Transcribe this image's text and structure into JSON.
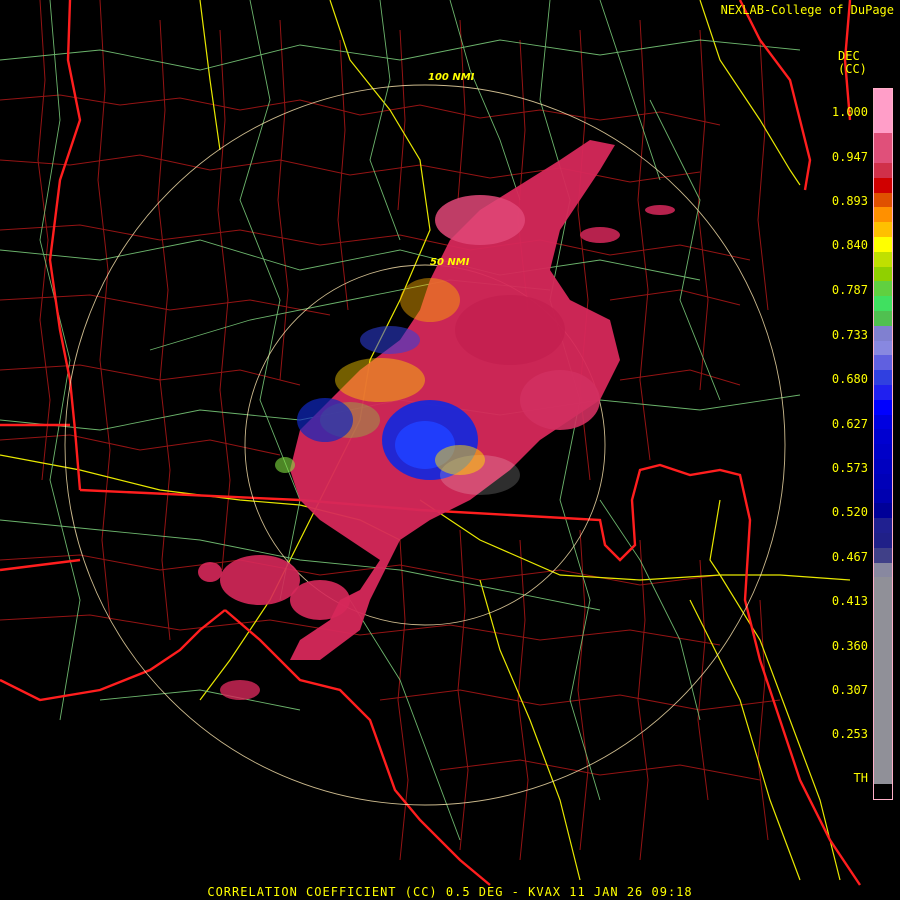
{
  "credit": "NEXLAB-College of DuPage",
  "units": {
    "line1": "DEC",
    "line2": "(CC)"
  },
  "rings": {
    "inner": "50 NMI",
    "outer": "100 NMI"
  },
  "colorbar": {
    "ticks": [
      "1.000",
      "0.947",
      "0.893",
      "0.840",
      "0.787",
      "0.733",
      "0.680",
      "0.627",
      "0.573",
      "0.520",
      "0.467",
      "0.413",
      "0.360",
      "0.307",
      "0.253",
      "TH"
    ],
    "colors": [
      "#ff9ec8",
      "#ff9ec8",
      "#ff9ec8",
      "#e0507a",
      "#e0507a",
      "#d0304a",
      "#d00000",
      "#e05000",
      "#ff9000",
      "#ffc000",
      "#ffff00",
      "#c0e000",
      "#90d000",
      "#60d040",
      "#40e060",
      "#50c050",
      "#8080d0",
      "#8888e0",
      "#6060e0",
      "#3040e0",
      "#2020f0",
      "#0000ff",
      "#0000e0",
      "#0000d0",
      "#0000c8",
      "#0000c0",
      "#0000b8",
      "#0000b0",
      "#000098",
      "#202090",
      "#202088",
      "#404088",
      "#8888a0",
      "#909098",
      "#909098",
      "#909098",
      "#909098",
      "#909098",
      "#909098",
      "#909098",
      "#909098",
      "#909098",
      "#909098",
      "#909098",
      "#909098",
      "#909098",
      "#909098",
      "#000000"
    ]
  },
  "title": "CORRELATION COEFFICIENT (CC) 0.5 DEG - KVAX 11 JAN 26 09:18"
}
